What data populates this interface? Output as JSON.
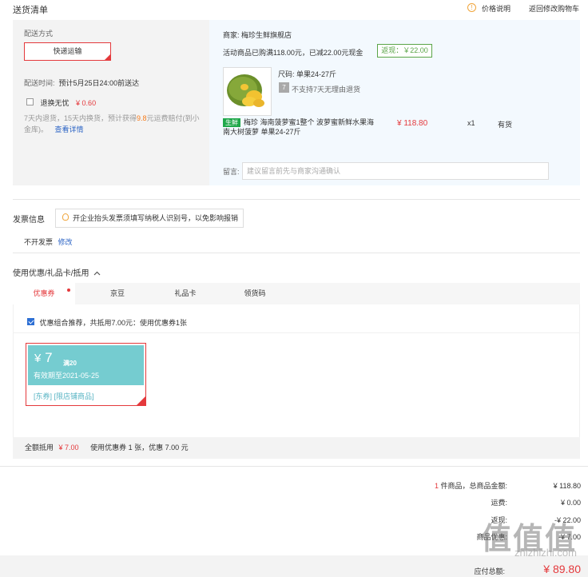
{
  "header": {
    "title": "送货清单",
    "price_info_link": "价格说明",
    "back_to_cart_link": "返回修改购物车"
  },
  "shipping": {
    "method_label": "配送方式",
    "express_button": "快递运输",
    "time_label": "配送时间:",
    "time_value": "预计5月25日24:00前送达",
    "return_free_label": "退换无忧",
    "return_free_price": "¥ 0.60",
    "return_note_prefix": "7天内退货，15天内换货，预计获得",
    "return_note_amount": "9.8",
    "return_note_suffix": "元运费赔付(到小金库)。",
    "view_details_link": "查看详情"
  },
  "merchant": {
    "label": "商家:",
    "name": "梅珍生鲜旗舰店",
    "promo_text": "活动商品已购满118.00元，已减22.00元现金",
    "cashback_tag": "返现：￥22.00"
  },
  "product": {
    "size_label": "尺码:",
    "size_value": "单果24-27斤",
    "no_return_icon": "7",
    "no_return_text": "不支持7天无理由退货",
    "fresh_badge": "生鲜",
    "name": "梅珍 海南菠萝蜜1整个 波萝蜜新鲜水果海南大树菠萝 单果24-27斤",
    "price": "¥ 118.80",
    "qty": "x1",
    "stock": "有货"
  },
  "memo": {
    "label": "留言:",
    "placeholder": "建议留言前先与商家沟通确认"
  },
  "invoice": {
    "title": "发票信息",
    "tip": "开企业抬头发票须填写纳税人识别号，以免影响报销",
    "status": "不开发票",
    "edit_link": "修改"
  },
  "coupons": {
    "title": "使用优惠/礼品卡/抵用",
    "tabs": [
      "优惠券",
      "京豆",
      "礼品卡",
      "领货码"
    ],
    "combo_text": "优惠组合推荐，共抵用7.00元：使用优惠券1张",
    "card": {
      "yen": "¥",
      "amount": "7",
      "condition": "满20",
      "expiry": "有效期至2021-05-25",
      "scope": "[东券] [限店铺商品]"
    },
    "summary_label": "全额抵用",
    "summary_amount": "¥ 7.00",
    "summary_text": "使用优惠券 1 张，优惠 7.00 元"
  },
  "totals": {
    "count": "1",
    "items_label": "件商品，总商品金额:",
    "items_value": "¥ 118.80",
    "shipping_label": "运费:",
    "shipping_value": "¥ 0.00",
    "discount_label": "返现:",
    "discount_value": "-¥ 22.00",
    "coupon_label": "商品优惠:",
    "coupon_value": "-¥ 7.00",
    "payable_label": "应付总额:",
    "payable_value": "¥ 89.80"
  },
  "watermark": {
    "logo": "值值值",
    "url": "zhizhizhi.com"
  },
  "colors": {
    "accent_red": "#e4393c",
    "coupon_teal": "#75ccd0",
    "link_blue": "#2c64c5",
    "cashback_green": "#5aa548"
  }
}
